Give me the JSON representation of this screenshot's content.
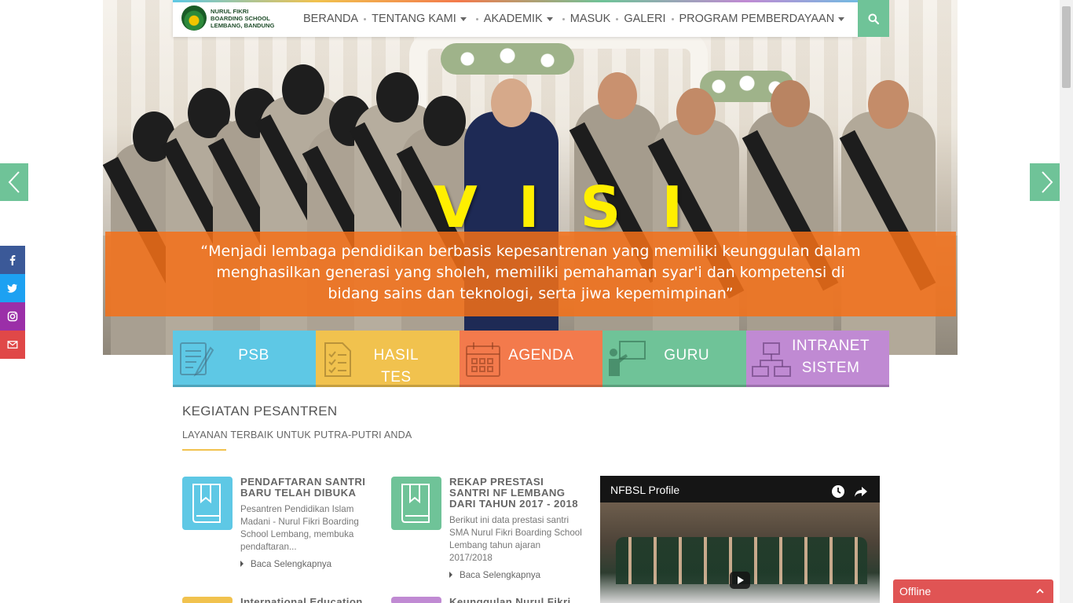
{
  "brand": {
    "logo_lines": [
      "NURUL FIKRI",
      "BOARDING SCHOOL",
      "LEMBANG, BANDUNG"
    ]
  },
  "nav": {
    "items": [
      {
        "label": "BERANDA",
        "dropdown": false
      },
      {
        "label": "TENTANG KAMI",
        "dropdown": true
      },
      {
        "label": "AKADEMIK",
        "dropdown": true
      },
      {
        "label": "MASUK",
        "dropdown": false
      },
      {
        "label": "GALERI",
        "dropdown": false
      },
      {
        "label": "PROGRAM PEMBERDAYAAN",
        "dropdown": true
      }
    ],
    "search_icon": "search-icon",
    "accent": "#6fc398"
  },
  "hero": {
    "heading": "VISI",
    "quote": "“Menjadi lembaga pendidikan berbasis kepesantrenan yang memiliki keunggulan dalam menghasilkan generasi yang sholeh, memiliki pemahaman syar'i dan kompetensi di bidang sains dan teknologi, serta jiwa kepemimpinan”",
    "heading_color": "#ffef00",
    "banner_color": "#f57018"
  },
  "social": [
    {
      "name": "facebook",
      "icon": "facebook-icon",
      "color": "#3b5998"
    },
    {
      "name": "twitter",
      "icon": "twitter-icon",
      "color": "#1da1f2"
    },
    {
      "name": "instagram",
      "icon": "instagram-icon",
      "color": "#9b2fa8"
    },
    {
      "name": "email",
      "icon": "envelope-icon",
      "color": "#e04848"
    }
  ],
  "tiles": [
    {
      "label": "PSB",
      "color": "#5ec8e5",
      "icon": "document-edit-icon"
    },
    {
      "label": "HASIL TES",
      "color": "#f1c24e",
      "icon": "checklist-icon"
    },
    {
      "label": "AGENDA",
      "color": "#f37a4c",
      "icon": "calendar-icon"
    },
    {
      "label": "GURU",
      "color": "#6fc398",
      "icon": "teacher-icon"
    },
    {
      "label": "INTRANET SISTEM",
      "color": "#c08ad3",
      "icon": "network-icon"
    }
  ],
  "section": {
    "title": "KEGIATAN PESANTREN",
    "subtitle": "LAYANAN TERBAIK UNTUK PUTRA-PUTRI ANDA"
  },
  "cards": [
    {
      "title": "PENDAFTARAN SANTRI BARU TELAH DIBUKA",
      "excerpt": "Pesantren Pendidikan Islam Madani - Nurul Fikri Boarding School Lembang, membuka pendaftaran...",
      "more": "Baca Selengkapnya",
      "color": "#5ec8e5"
    },
    {
      "title": "REKAP PRESTASI SANTRI NF LEMBANG DARI TAHUN 2017 - 2018",
      "excerpt": "Berikut ini data prestasi santri SMA Nurul Fikri Boarding School Lembang tahun ajaran 2017/2018",
      "more": "Baca Selengkapnya",
      "color": "#6fc398"
    },
    {
      "title": "International Education",
      "color": "#f1c24e"
    },
    {
      "title": "Keunggulan Nurul Fikri",
      "color": "#c08ad3"
    }
  ],
  "video": {
    "title": "NFBSL Profile"
  },
  "chat": {
    "status": "Offline",
    "color": "#e05454"
  }
}
